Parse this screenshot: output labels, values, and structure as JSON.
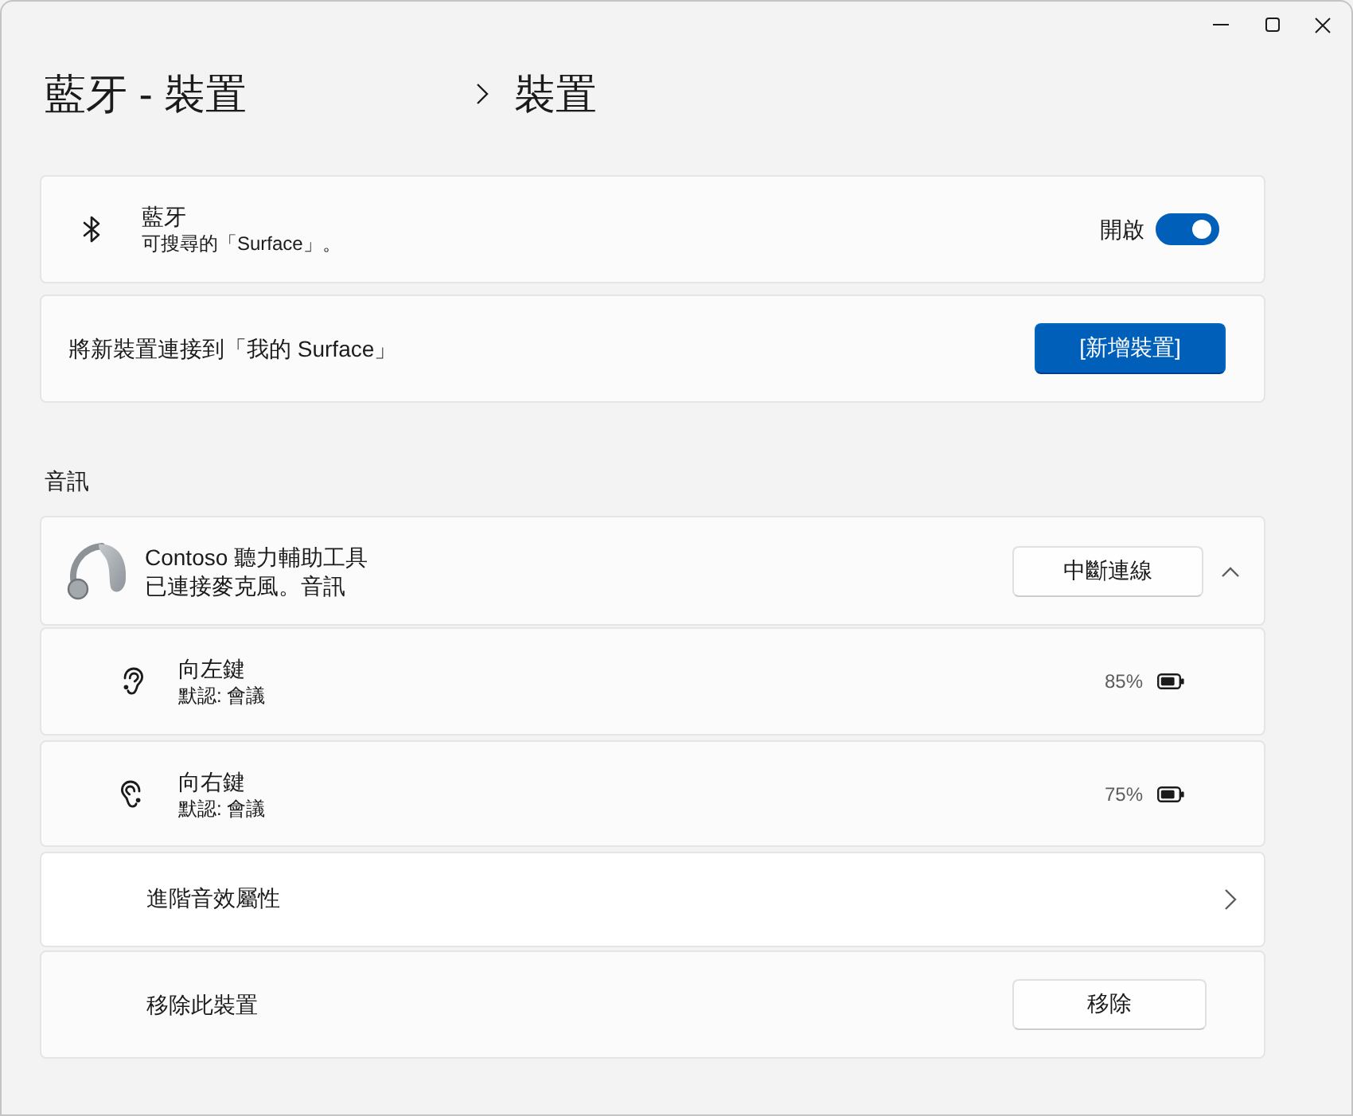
{
  "breadcrumb": [
    {
      "label": "藍牙 - 裝置"
    },
    {
      "label": "裝置"
    }
  ],
  "bluetooth": {
    "title": "藍牙",
    "subtitle": "可搜尋的「Surface」。",
    "toggle_label": "開啟",
    "on": true
  },
  "add_device": {
    "label": "將新裝置連接到「我的 Surface」",
    "button": "[新增裝置]"
  },
  "audio": {
    "section_title": "音訊",
    "device": {
      "name": "Contoso 聽力輔助工具",
      "status": "已連接麥克風。音訊",
      "button": "中斷連線",
      "expanded": true,
      "sides": [
        {
          "kind": "left",
          "name": "向左鍵",
          "preset": "默認: 會議",
          "battery": "85%"
        },
        {
          "kind": "right",
          "name": "向右鍵",
          "preset": "默認: 會議",
          "battery": "75%"
        }
      ]
    },
    "options": [
      {
        "kind": "link",
        "label": "進階音效屬性"
      },
      {
        "kind": "action",
        "label": "移除此裝置",
        "button": "移除"
      }
    ]
  }
}
